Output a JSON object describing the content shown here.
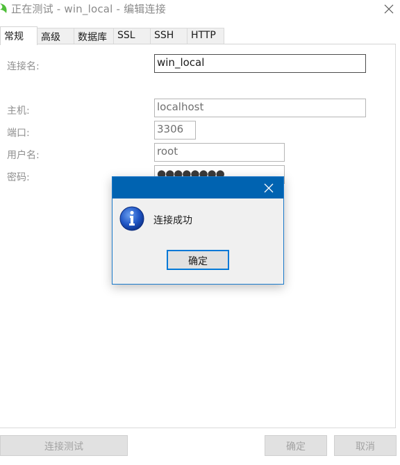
{
  "window": {
    "title": "正在测试 - win_local - 编辑连接"
  },
  "tabs": [
    {
      "label": "常规",
      "active": true
    },
    {
      "label": "高级"
    },
    {
      "label": "数据库"
    },
    {
      "label": "SSL"
    },
    {
      "label": "SSH"
    },
    {
      "label": "HTTP"
    }
  ],
  "form": {
    "connection_name_label": "连接名:",
    "connection_name_value": "win_local",
    "host_label": "主机:",
    "host_value": "localhost",
    "port_label": "端口:",
    "port_value": "3306",
    "username_label": "用户名:",
    "username_value": "root",
    "password_label": "密码:",
    "password_mask": "●●●●●●●●"
  },
  "buttons": {
    "test_connection": "连接测试",
    "ok": "确定",
    "cancel": "取消"
  },
  "dialog": {
    "message": "连接成功",
    "ok_label": "确定"
  },
  "icons": {
    "app": "navicat-app-icon",
    "close": "close-icon",
    "info": "info-icon"
  },
  "colors": {
    "dialog_titlebar": "#0063b1",
    "focus_border": "#0078d7",
    "app_icon_green": "#4fbf3a"
  }
}
